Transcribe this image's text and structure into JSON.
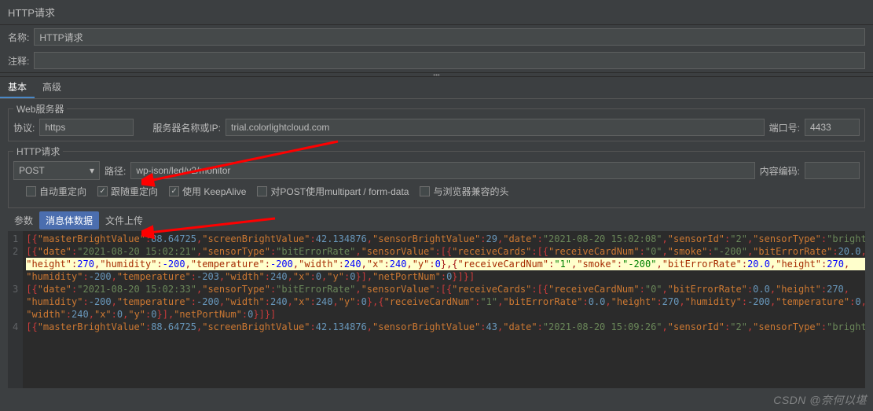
{
  "header": {
    "title": "HTTP请求"
  },
  "fields": {
    "name_label": "名称:",
    "name_value": "HTTP请求",
    "comment_label": "注释:",
    "comment_value": ""
  },
  "main_tabs": [
    {
      "label": "基本",
      "active": true
    },
    {
      "label": "高级",
      "active": false
    }
  ],
  "webserver": {
    "legend": "Web服务器",
    "protocol_label": "协议:",
    "protocol_value": "https",
    "server_label": "服务器名称或IP:",
    "server_value": "trial.colorlightcloud.com",
    "port_label": "端口号:",
    "port_value": "4433"
  },
  "httpreq": {
    "legend": "HTTP请求",
    "method": "POST",
    "path_label": "路径:",
    "path_value": "wp-json/led/v2/monitor",
    "encoding_label": "内容编码:",
    "encoding_value": ""
  },
  "checkboxes": [
    {
      "label": "自动重定向",
      "checked": false
    },
    {
      "label": "跟随重定向",
      "checked": true
    },
    {
      "label": "使用 KeepAlive",
      "checked": true
    },
    {
      "label": "对POST使用multipart / form-data",
      "checked": false
    },
    {
      "label": "与浏览器兼容的头",
      "checked": false
    }
  ],
  "subtabs": [
    {
      "label": "参数",
      "active": false
    },
    {
      "label": "消息体数据",
      "active": true
    },
    {
      "label": "文件上传",
      "active": false
    }
  ],
  "code": {
    "line_numbers": [
      "1",
      "2",
      "",
      "",
      "3",
      "",
      "",
      "4"
    ],
    "tokens": [
      [
        {
          "t": "[{",
          "c": "k-red"
        },
        {
          "t": "\"masterBrightValue\"",
          "c": "k-orange"
        },
        {
          "t": ":",
          "c": "k-red"
        },
        {
          "t": "88.64725",
          "c": "k-blue"
        },
        {
          "t": ",",
          "c": "k-red"
        },
        {
          "t": "\"screenBrightValue\"",
          "c": "k-orange"
        },
        {
          "t": ":",
          "c": "k-red"
        },
        {
          "t": "42.134876",
          "c": "k-blue"
        },
        {
          "t": ",",
          "c": "k-red"
        },
        {
          "t": "\"sensorBrightValue\"",
          "c": "k-orange"
        },
        {
          "t": ":",
          "c": "k-red"
        },
        {
          "t": "29",
          "c": "k-blue"
        },
        {
          "t": ",",
          "c": "k-red"
        },
        {
          "t": "\"date\"",
          "c": "k-orange"
        },
        {
          "t": ":",
          "c": "k-red"
        },
        {
          "t": "\"2021-08-20 15:02:08\"",
          "c": "k-green"
        },
        {
          "t": ",",
          "c": "k-red"
        },
        {
          "t": "\"sensorId\"",
          "c": "k-orange"
        },
        {
          "t": ":",
          "c": "k-red"
        },
        {
          "t": "\"2\"",
          "c": "k-green"
        },
        {
          "t": ",",
          "c": "k-red"
        },
        {
          "t": "\"sensorType\"",
          "c": "k-orange"
        },
        {
          "t": ":",
          "c": "k-red"
        },
        {
          "t": "\"bright\"",
          "c": "k-green"
        },
        {
          "t": "}]",
          "c": "k-red"
        }
      ],
      [
        {
          "t": "[{",
          "c": "k-red"
        },
        {
          "t": "\"date\"",
          "c": "k-orange"
        },
        {
          "t": ":",
          "c": "k-red"
        },
        {
          "t": "\"2021-08-20 15:02:21\"",
          "c": "k-green"
        },
        {
          "t": ",",
          "c": "k-red"
        },
        {
          "t": "\"sensorType\"",
          "c": "k-orange"
        },
        {
          "t": ":",
          "c": "k-red"
        },
        {
          "t": "\"bitErrorRate\"",
          "c": "k-green"
        },
        {
          "t": ",",
          "c": "k-red"
        },
        {
          "t": "\"sensorValue\"",
          "c": "k-orange"
        },
        {
          "t": ":",
          "c": "k-red"
        },
        {
          "t": "[{",
          "c": "k-red"
        },
        {
          "t": "\"receiveCards\"",
          "c": "k-orange"
        },
        {
          "t": ":",
          "c": "k-red"
        },
        {
          "t": "[{",
          "c": "k-red"
        },
        {
          "t": "\"receiveCardNum\"",
          "c": "k-orange"
        },
        {
          "t": ":",
          "c": "k-red"
        },
        {
          "t": "\"0\"",
          "c": "k-green"
        },
        {
          "t": ",",
          "c": "k-red"
        },
        {
          "t": "\"smoke\"",
          "c": "k-orange"
        },
        {
          "t": ":",
          "c": "k-red"
        },
        {
          "t": "\"-200\"",
          "c": "k-green"
        },
        {
          "t": ",",
          "c": "k-red"
        },
        {
          "t": "\"bitErrorRate\"",
          "c": "k-orange"
        },
        {
          "t": ":",
          "c": "k-red"
        },
        {
          "t": "20.0",
          "c": "k-blue"
        },
        {
          "t": ",",
          "c": "k-red"
        }
      ],
      [
        {
          "t": "\"height\"",
          "c": "k-orange"
        },
        {
          "t": ":",
          "c": "k-red"
        },
        {
          "t": "270",
          "c": "k-blue"
        },
        {
          "t": ",",
          "c": "k-red"
        },
        {
          "t": "\"humidity\"",
          "c": "k-orange"
        },
        {
          "t": ":",
          "c": "k-red"
        },
        {
          "t": "-200",
          "c": "k-blue"
        },
        {
          "t": ",",
          "c": "k-red"
        },
        {
          "t": "\"temperature\"",
          "c": "k-orange"
        },
        {
          "t": ":",
          "c": "k-red"
        },
        {
          "t": "-200",
          "c": "k-blue"
        },
        {
          "t": ",",
          "c": "k-red"
        },
        {
          "t": "\"width\"",
          "c": "k-orange"
        },
        {
          "t": ":",
          "c": "k-red"
        },
        {
          "t": "240",
          "c": "k-blue"
        },
        {
          "t": ",",
          "c": "k-red"
        },
        {
          "t": "\"x\"",
          "c": "k-orange"
        },
        {
          "t": ":",
          "c": "k-red"
        },
        {
          "t": "240",
          "c": "k-blue"
        },
        {
          "t": ",",
          "c": "k-red"
        },
        {
          "t": "\"y\"",
          "c": "k-orange"
        },
        {
          "t": ":",
          "c": "k-red"
        },
        {
          "t": "0",
          "c": "k-blue"
        },
        {
          "t": "},{",
          "c": "k-red"
        },
        {
          "t": "\"receiveCardNum\"",
          "c": "k-orange"
        },
        {
          "t": ":",
          "c": "k-red"
        },
        {
          "t": "\"1\"",
          "c": "k-green"
        },
        {
          "t": ",",
          "c": "k-red"
        },
        {
          "t": "\"smoke\"",
          "c": "k-orange"
        },
        {
          "t": ":",
          "c": "k-red"
        },
        {
          "t": "\"-200\"",
          "c": "k-green"
        },
        {
          "t": ",",
          "c": "k-red"
        },
        {
          "t": "\"bitErrorRate\"",
          "c": "k-orange"
        },
        {
          "t": ":",
          "c": "k-red"
        },
        {
          "t": "20.0",
          "c": "k-blue"
        },
        {
          "t": ",",
          "c": "k-red"
        },
        {
          "t": "\"height\"",
          "c": "k-orange"
        },
        {
          "t": ":",
          "c": "k-red"
        },
        {
          "t": "270",
          "c": "k-blue"
        },
        {
          "t": ",",
          "c": "k-red"
        }
      ],
      [
        {
          "t": "\"humidity\"",
          "c": "k-orange"
        },
        {
          "t": ":",
          "c": "k-red"
        },
        {
          "t": "-200",
          "c": "k-blue"
        },
        {
          "t": ",",
          "c": "k-red"
        },
        {
          "t": "\"temperature\"",
          "c": "k-orange"
        },
        {
          "t": ":",
          "c": "k-red"
        },
        {
          "t": "-203",
          "c": "k-blue"
        },
        {
          "t": ",",
          "c": "k-red"
        },
        {
          "t": "\"width\"",
          "c": "k-orange"
        },
        {
          "t": ":",
          "c": "k-red"
        },
        {
          "t": "240",
          "c": "k-blue"
        },
        {
          "t": ",",
          "c": "k-red"
        },
        {
          "t": "\"x\"",
          "c": "k-orange"
        },
        {
          "t": ":",
          "c": "k-red"
        },
        {
          "t": "0",
          "c": "k-blue"
        },
        {
          "t": ",",
          "c": "k-red"
        },
        {
          "t": "\"y\"",
          "c": "k-orange"
        },
        {
          "t": ":",
          "c": "k-red"
        },
        {
          "t": "0",
          "c": "k-blue"
        },
        {
          "t": "}],",
          "c": "k-red"
        },
        {
          "t": "\"netPortNum\"",
          "c": "k-orange"
        },
        {
          "t": ":",
          "c": "k-red"
        },
        {
          "t": "0",
          "c": "k-blue"
        },
        {
          "t": "}]}]",
          "c": "k-red"
        }
      ],
      [
        {
          "t": "[{",
          "c": "k-red"
        },
        {
          "t": "\"date\"",
          "c": "k-orange"
        },
        {
          "t": ":",
          "c": "k-red"
        },
        {
          "t": "\"2021-08-20 15:02:33\"",
          "c": "k-green"
        },
        {
          "t": ",",
          "c": "k-red"
        },
        {
          "t": "\"sensorType\"",
          "c": "k-orange"
        },
        {
          "t": ":",
          "c": "k-red"
        },
        {
          "t": "\"bitErrorRate\"",
          "c": "k-green"
        },
        {
          "t": ",",
          "c": "k-red"
        },
        {
          "t": "\"sensorValue\"",
          "c": "k-orange"
        },
        {
          "t": ":",
          "c": "k-red"
        },
        {
          "t": "[{",
          "c": "k-red"
        },
        {
          "t": "\"receiveCards\"",
          "c": "k-orange"
        },
        {
          "t": ":",
          "c": "k-red"
        },
        {
          "t": "[{",
          "c": "k-red"
        },
        {
          "t": "\"receiveCardNum\"",
          "c": "k-orange"
        },
        {
          "t": ":",
          "c": "k-red"
        },
        {
          "t": "\"0\"",
          "c": "k-green"
        },
        {
          "t": ",",
          "c": "k-red"
        },
        {
          "t": "\"bitErrorRate\"",
          "c": "k-orange"
        },
        {
          "t": ":",
          "c": "k-red"
        },
        {
          "t": "0.0",
          "c": "k-blue"
        },
        {
          "t": ",",
          "c": "k-red"
        },
        {
          "t": "\"height\"",
          "c": "k-orange"
        },
        {
          "t": ":",
          "c": "k-red"
        },
        {
          "t": "270",
          "c": "k-blue"
        },
        {
          "t": ",",
          "c": "k-red"
        }
      ],
      [
        {
          "t": "\"humidity\"",
          "c": "k-orange"
        },
        {
          "t": ":",
          "c": "k-red"
        },
        {
          "t": "-200",
          "c": "k-blue"
        },
        {
          "t": ",",
          "c": "k-red"
        },
        {
          "t": "\"temperature\"",
          "c": "k-orange"
        },
        {
          "t": ":",
          "c": "k-red"
        },
        {
          "t": "-200",
          "c": "k-blue"
        },
        {
          "t": ",",
          "c": "k-red"
        },
        {
          "t": "\"width\"",
          "c": "k-orange"
        },
        {
          "t": ":",
          "c": "k-red"
        },
        {
          "t": "240",
          "c": "k-blue"
        },
        {
          "t": ",",
          "c": "k-red"
        },
        {
          "t": "\"x\"",
          "c": "k-orange"
        },
        {
          "t": ":",
          "c": "k-red"
        },
        {
          "t": "240",
          "c": "k-blue"
        },
        {
          "t": ",",
          "c": "k-red"
        },
        {
          "t": "\"y\"",
          "c": "k-orange"
        },
        {
          "t": ":",
          "c": "k-red"
        },
        {
          "t": "0",
          "c": "k-blue"
        },
        {
          "t": "},{",
          "c": "k-red"
        },
        {
          "t": "\"receiveCardNum\"",
          "c": "k-orange"
        },
        {
          "t": ":",
          "c": "k-red"
        },
        {
          "t": "\"1\"",
          "c": "k-green"
        },
        {
          "t": ",",
          "c": "k-red"
        },
        {
          "t": "\"bitErrorRate\"",
          "c": "k-orange"
        },
        {
          "t": ":",
          "c": "k-red"
        },
        {
          "t": "0.0",
          "c": "k-blue"
        },
        {
          "t": ",",
          "c": "k-red"
        },
        {
          "t": "\"height\"",
          "c": "k-orange"
        },
        {
          "t": ":",
          "c": "k-red"
        },
        {
          "t": "270",
          "c": "k-blue"
        },
        {
          "t": ",",
          "c": "k-red"
        },
        {
          "t": "\"humidity\"",
          "c": "k-orange"
        },
        {
          "t": ":",
          "c": "k-red"
        },
        {
          "t": "-200",
          "c": "k-blue"
        },
        {
          "t": ",",
          "c": "k-red"
        },
        {
          "t": "\"temperature\"",
          "c": "k-orange"
        },
        {
          "t": ":",
          "c": "k-red"
        },
        {
          "t": "0",
          "c": "k-blue"
        },
        {
          "t": ",",
          "c": "k-red"
        }
      ],
      [
        {
          "t": "\"width\"",
          "c": "k-orange"
        },
        {
          "t": ":",
          "c": "k-red"
        },
        {
          "t": "240",
          "c": "k-blue"
        },
        {
          "t": ",",
          "c": "k-red"
        },
        {
          "t": "\"x\"",
          "c": "k-orange"
        },
        {
          "t": ":",
          "c": "k-red"
        },
        {
          "t": "0",
          "c": "k-blue"
        },
        {
          "t": ",",
          "c": "k-red"
        },
        {
          "t": "\"y\"",
          "c": "k-orange"
        },
        {
          "t": ":",
          "c": "k-red"
        },
        {
          "t": "0",
          "c": "k-blue"
        },
        {
          "t": "}],",
          "c": "k-red"
        },
        {
          "t": "\"netPortNum\"",
          "c": "k-orange"
        },
        {
          "t": ":",
          "c": "k-red"
        },
        {
          "t": "0",
          "c": "k-blue"
        },
        {
          "t": "}]}]",
          "c": "k-red"
        }
      ],
      [
        {
          "t": "[{",
          "c": "k-red"
        },
        {
          "t": "\"masterBrightValue\"",
          "c": "k-orange"
        },
        {
          "t": ":",
          "c": "k-red"
        },
        {
          "t": "88.64725",
          "c": "k-blue"
        },
        {
          "t": ",",
          "c": "k-red"
        },
        {
          "t": "\"screenBrightValue\"",
          "c": "k-orange"
        },
        {
          "t": ":",
          "c": "k-red"
        },
        {
          "t": "42.134876",
          "c": "k-blue"
        },
        {
          "t": ",",
          "c": "k-red"
        },
        {
          "t": "\"sensorBrightValue\"",
          "c": "k-orange"
        },
        {
          "t": ":",
          "c": "k-red"
        },
        {
          "t": "43",
          "c": "k-blue"
        },
        {
          "t": ",",
          "c": "k-red"
        },
        {
          "t": "\"date\"",
          "c": "k-orange"
        },
        {
          "t": ":",
          "c": "k-red"
        },
        {
          "t": "\"2021-08-20 15:09:26\"",
          "c": "k-green"
        },
        {
          "t": ",",
          "c": "k-red"
        },
        {
          "t": "\"sensorId\"",
          "c": "k-orange"
        },
        {
          "t": ":",
          "c": "k-red"
        },
        {
          "t": "\"2\"",
          "c": "k-green"
        },
        {
          "t": ",",
          "c": "k-red"
        },
        {
          "t": "\"sensorType\"",
          "c": "k-orange"
        },
        {
          "t": ":",
          "c": "k-red"
        },
        {
          "t": "\"bright\"",
          "c": "k-green"
        },
        {
          "t": "}]",
          "c": "k-red"
        }
      ]
    ],
    "highlight_index": 2
  },
  "watermark": "CSDN @奈何以堪"
}
